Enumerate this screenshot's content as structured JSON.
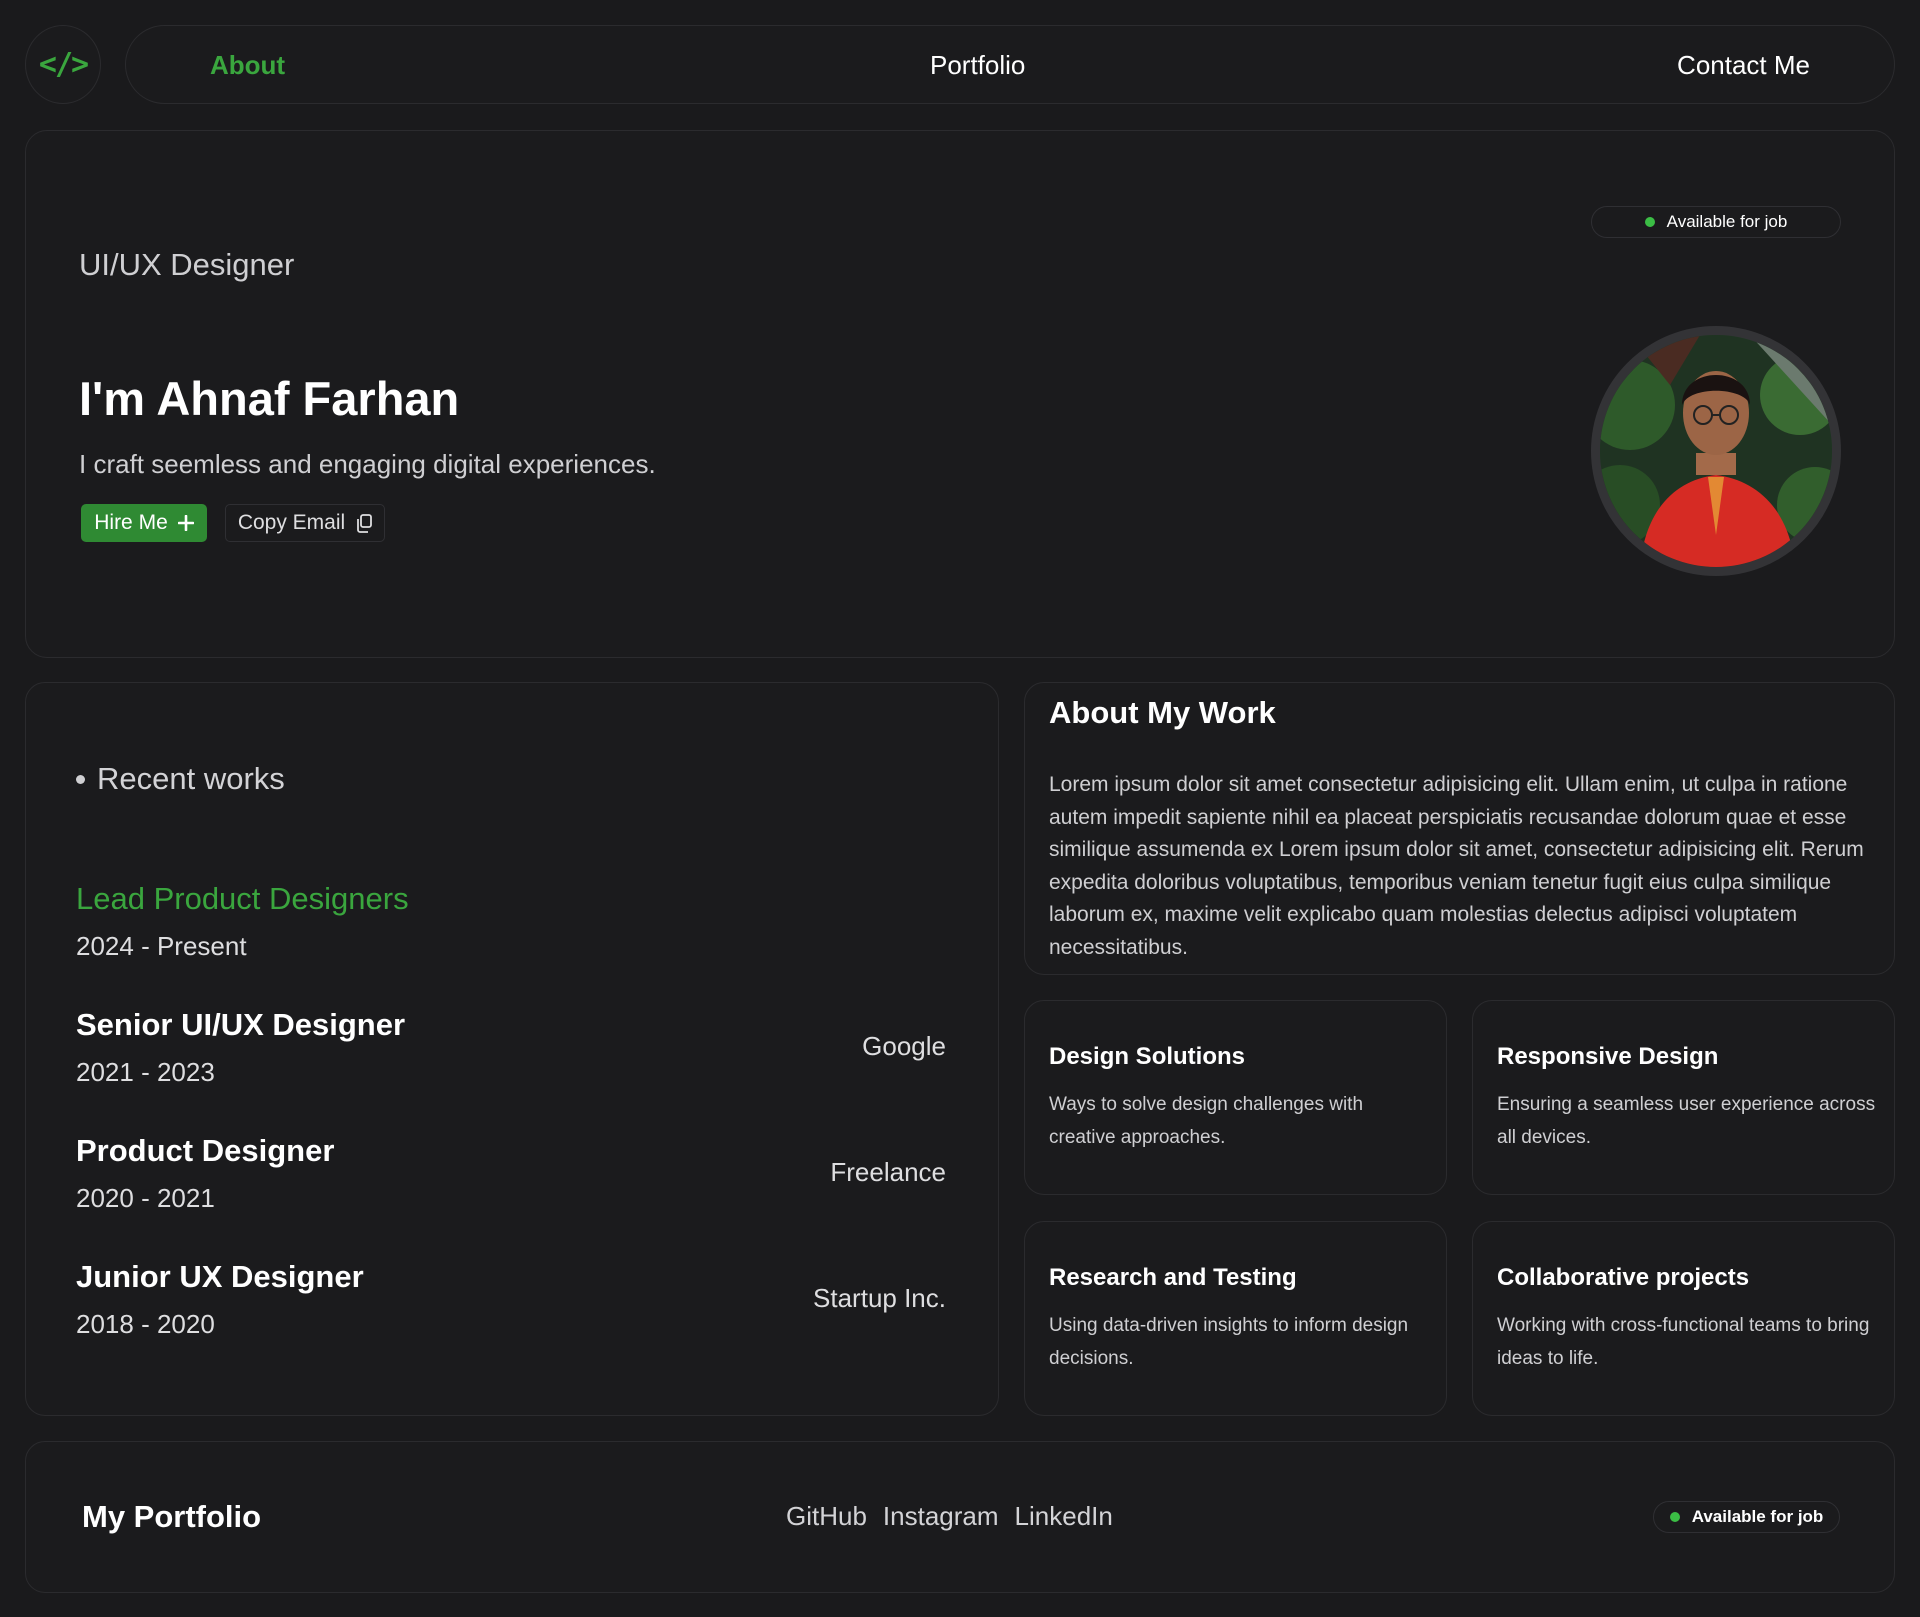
{
  "nav": {
    "logo_icon": "code-icon",
    "logo_text": "</>",
    "items": [
      "About",
      "Portfolio",
      "Contact Me"
    ],
    "active": "About"
  },
  "hero": {
    "role": "UI/UX Designer",
    "name": "I'm Ahnaf Farhan",
    "tagline": "I craft seemless and engaging digital experiences.",
    "hire_label": "Hire Me",
    "hire_icon": "plus-icon",
    "copy_label": "Copy Email",
    "copy_icon": "copy-icon",
    "badge": "Available for job",
    "avatar": "profile-photo"
  },
  "works": {
    "heading": "Recent works",
    "items": [
      {
        "title": "Lead Product Designers",
        "period": "2024 - Present",
        "company": ""
      },
      {
        "title": "Senior UI/UX Designer",
        "period": "2021 - 2023",
        "company": "Google"
      },
      {
        "title": "Product Designer",
        "period": "2020 - 2021",
        "company": "Freelance"
      },
      {
        "title": "Junior UX Designer",
        "period": "2018 - 2020",
        "company": "Startup Inc."
      }
    ]
  },
  "about": {
    "title": "About My Work",
    "text": "Lorem ipsum dolor sit amet consectetur adipisicing elit. Ullam enim, ut culpa in ratione autem impedit sapiente nihil ea placeat perspiciatis recusandae dolorum quae et esse similique assumenda ex Lorem ipsum dolor sit amet, consectetur adipisicing elit. Rerum expedita doloribus voluptatibus, temporibus veniam tenetur fugit eius culpa similique laborum ex, maxime velit explicabo quam molestias delectus adipisci voluptatem necessitatibus."
  },
  "services": [
    {
      "title": "Design Solutions",
      "desc": "Ways to solve design challenges with creative approaches."
    },
    {
      "title": "Responsive Design",
      "desc": "Ensuring a seamless user experience across all devices."
    },
    {
      "title": "Research and Testing",
      "desc": "Using data-driven insights to inform design decisions."
    },
    {
      "title": "Collaborative projects",
      "desc": "Working with cross-functional teams to bring ideas to life."
    }
  ],
  "footer": {
    "title": "My Portfolio",
    "links": [
      "GitHub",
      "Instagram",
      "LinkedIn"
    ],
    "badge": "Available for job"
  },
  "colors": {
    "background": "#1a1a1c",
    "card": "#1b1b1d",
    "border": "#2b2b2e",
    "accent": "#3aa63e",
    "button": "#2f8a33",
    "status_dot": "#3bbd45"
  }
}
